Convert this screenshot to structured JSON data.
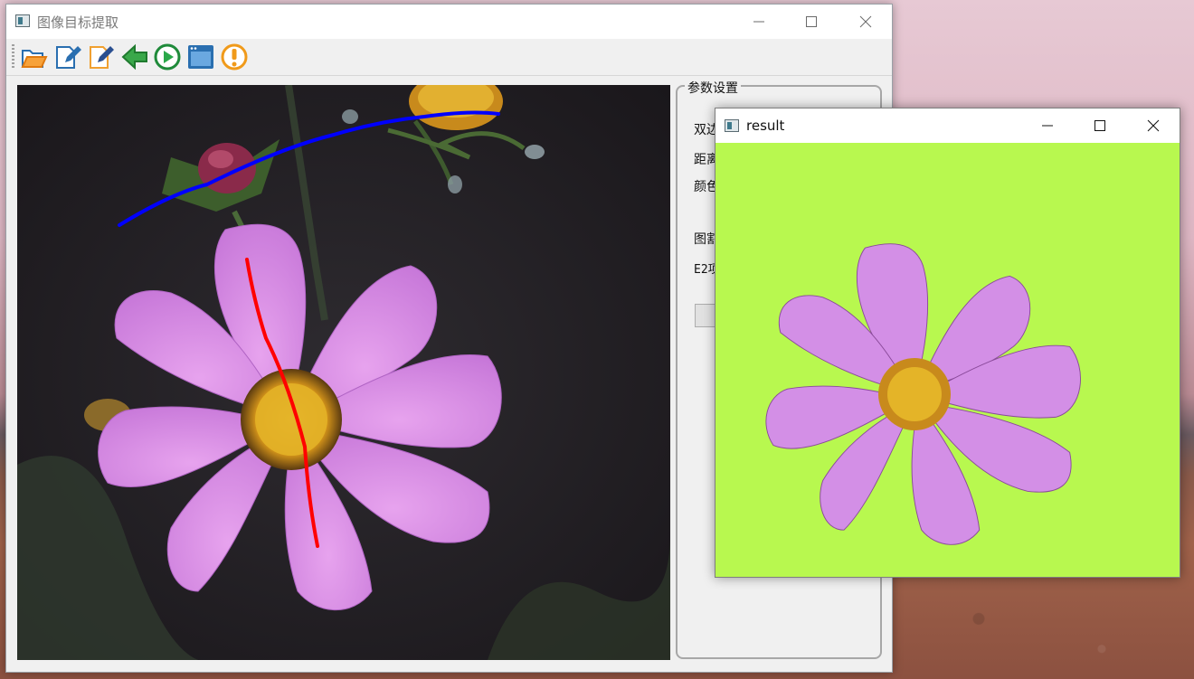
{
  "main_window": {
    "title": "图像目标提取",
    "toolbar_icons": [
      "open-folder-icon",
      "edit-document-icon",
      "pen-edit-icon",
      "back-arrow-icon",
      "play-icon",
      "window-icon",
      "warning-icon"
    ]
  },
  "params_panel": {
    "legend": "参数设置",
    "labels": [
      "双边",
      "距离",
      "颜色",
      "图割",
      "E2项"
    ]
  },
  "result_window": {
    "title": "result"
  },
  "colors": {
    "result_background": "#b8f84f",
    "foreground_stroke": "#ff0000",
    "background_stroke": "#0000ff"
  }
}
